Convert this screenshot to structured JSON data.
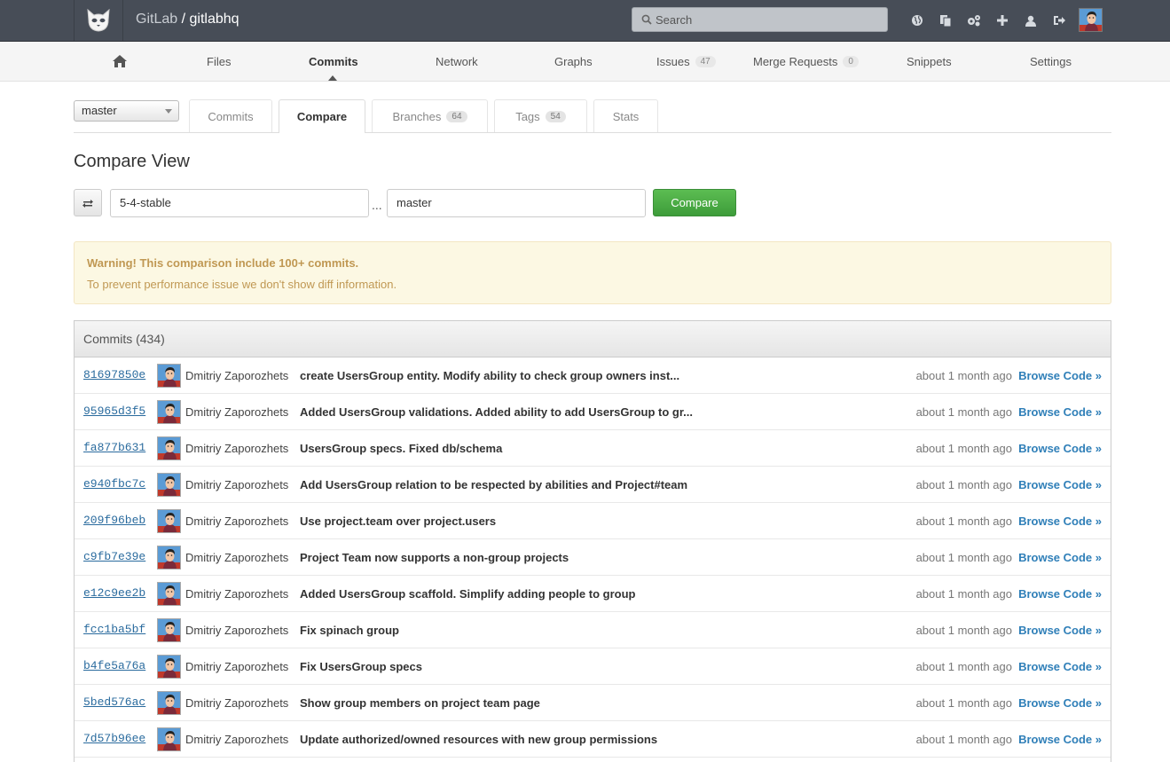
{
  "header": {
    "namespace": "GitLab",
    "separator": " / ",
    "project": "gitlabhq",
    "search_placeholder": "Search",
    "icons": [
      "globe-icon",
      "copy-icon",
      "admin-icon",
      "plus-icon",
      "user-icon",
      "logout-icon"
    ]
  },
  "nav": {
    "home_icon": "home-icon",
    "files": "Files",
    "commits": "Commits",
    "network": "Network",
    "graphs": "Graphs",
    "issues": "Issues",
    "issues_count": "47",
    "merge_requests": "Merge Requests",
    "merge_requests_count": "0",
    "snippets": "Snippets",
    "settings": "Settings"
  },
  "ref_select": {
    "value": "master"
  },
  "tabs": {
    "commits": "Commits",
    "compare": "Compare",
    "branches": "Branches",
    "branches_count": "64",
    "tags": "Tags",
    "tags_count": "54",
    "stats": "Stats"
  },
  "compare": {
    "title": "Compare View",
    "from": "5-4-stable",
    "dots": "...",
    "to": "master",
    "button": "Compare"
  },
  "warning": {
    "title": "Warning! This comparison include 100+ commits.",
    "text": "To prevent performance issue we don't show diff information."
  },
  "commits": {
    "header": "Commits (434)",
    "browse_label": "Browse Code »",
    "rows": [
      {
        "sha": "81697850e",
        "author": "Dmitriy Zaporozhets",
        "message": "create UsersGroup entity. Modify ability to check group owners inst...",
        "time": "about 1 month ago"
      },
      {
        "sha": "95965d3f5",
        "author": "Dmitriy Zaporozhets",
        "message": "Added UsersGroup validations. Added ability to add UsersGroup to gr...",
        "time": "about 1 month ago"
      },
      {
        "sha": "fa877b631",
        "author": "Dmitriy Zaporozhets",
        "message": "UsersGroup specs. Fixed db/schema",
        "time": "about 1 month ago"
      },
      {
        "sha": "e940fbc7c",
        "author": "Dmitriy Zaporozhets",
        "message": "Add UsersGroup relation to be respected by abilities and Project#team",
        "time": "about 1 month ago"
      },
      {
        "sha": "209f96beb",
        "author": "Dmitriy Zaporozhets",
        "message": "Use project.team over project.users",
        "time": "about 1 month ago"
      },
      {
        "sha": "c9fb7e39e",
        "author": "Dmitriy Zaporozhets",
        "message": "Project Team now supports a non-group projects",
        "time": "about 1 month ago"
      },
      {
        "sha": "e12c9ee2b",
        "author": "Dmitriy Zaporozhets",
        "message": "Added UsersGroup scaffold. Simplify adding people to group",
        "time": "about 1 month ago"
      },
      {
        "sha": "fcc1ba5bf",
        "author": "Dmitriy Zaporozhets",
        "message": "Fix spinach group",
        "time": "about 1 month ago"
      },
      {
        "sha": "b4fe5a76a",
        "author": "Dmitriy Zaporozhets",
        "message": "Fix UsersGroup specs",
        "time": "about 1 month ago"
      },
      {
        "sha": "5bed576ac",
        "author": "Dmitriy Zaporozhets",
        "message": "Show group members on project team page",
        "time": "about 1 month ago"
      },
      {
        "sha": "7d57b96ee",
        "author": "Dmitriy Zaporozhets",
        "message": "Update authorized/owned resources with new group permissions",
        "time": "about 1 month ago"
      }
    ]
  }
}
